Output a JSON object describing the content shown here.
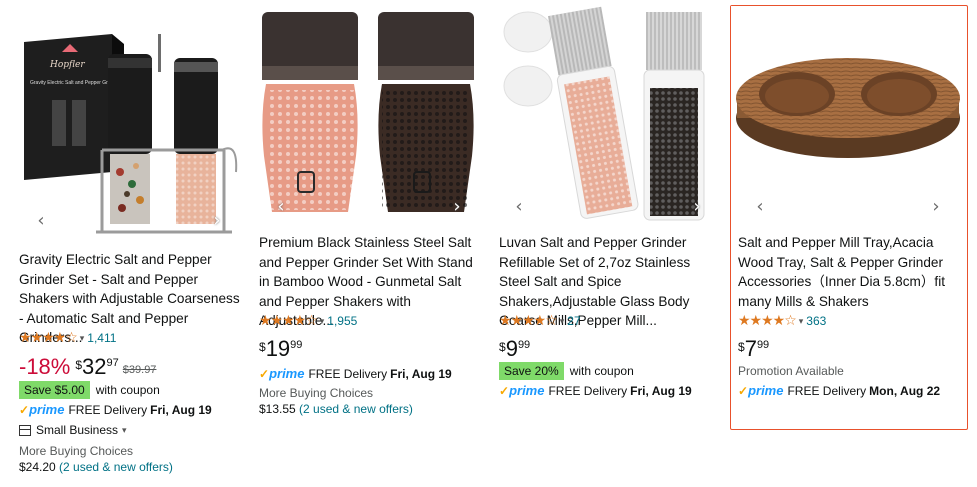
{
  "cards": [
    {
      "title": "Gravity Electric Salt and Pepper Grinder Set - Salt and Pepper Shakers with Adjustable Coarseness - Automatic Salt and Pepper Grinders...",
      "stars": "★★★★☆",
      "rating_count": "1,411",
      "discount": "-18%",
      "price_symbol": "$",
      "price_whole": "32",
      "price_fraction": "97",
      "list_price": "$39.97",
      "coupon_tag": "Save $5.00",
      "coupon_text": "with coupon",
      "prime_label": "prime",
      "delivery_text": "FREE Delivery",
      "delivery_date": "Fri, Aug 19",
      "small_business": "Small Business",
      "buying_choices": "More Buying Choices",
      "offer_price": "$24.20",
      "offer_link": "(2 used & new offers)",
      "image_brand_text": "Hopfler",
      "image_box_caption": "Gravity Electric Salt and Pepper Gr..."
    },
    {
      "title": "Premium Black Stainless Steel Salt and Pepper Grinder Set With Stand in Bamboo Wood - Gunmetal Salt and Pepper Shakers with Adjustable...",
      "stars": "★★★★☆",
      "rating_count": "1,955",
      "price_symbol": "$",
      "price_whole": "19",
      "price_fraction": "99",
      "prime_label": "prime",
      "delivery_text": "FREE Delivery",
      "delivery_date": "Fri, Aug 19",
      "buying_choices": "More Buying Choices",
      "offer_price": "$13.55",
      "offer_link": "(2 used & new offers)"
    },
    {
      "title": "Luvan Salt and Pepper Grinder Refillable Set of 2,7oz Stainless Steel Salt and Spice Shakers,Adjustable Glass Body Coarse Mills,Pepper Mill...",
      "stars": "★★★★☆",
      "rating_count": "27",
      "price_symbol": "$",
      "price_whole": "9",
      "price_fraction": "99",
      "coupon_tag": "Save 20%",
      "coupon_text": "with coupon",
      "prime_label": "prime",
      "delivery_text": "FREE Delivery",
      "delivery_date": "Fri, Aug 19"
    },
    {
      "title": "Salt and Pepper Mill Tray,Acacia Wood Tray, Salt & Pepper Grinder Accessories（Inner Dia 5.8cm）fit many Mills & Shakers",
      "stars": "★★★★☆",
      "rating_count": "363",
      "price_symbol": "$",
      "price_whole": "7",
      "price_fraction": "99",
      "promotion": "Promotion Available",
      "prime_label": "prime",
      "delivery_text": "FREE Delivery",
      "delivery_date": "Mon, Aug 22"
    }
  ],
  "icons": {
    "prev": "chevron-left-icon",
    "next": "chevron-right-icon",
    "rating_dropdown": "chevron-down-icon",
    "small_business": "store-icon"
  },
  "colors": {
    "star": "#de7921",
    "link": "#007185",
    "discount": "#cc0c39",
    "coupon": "#7fda69",
    "prime": "#1a98ff",
    "highlight_border": "#e8512c"
  }
}
